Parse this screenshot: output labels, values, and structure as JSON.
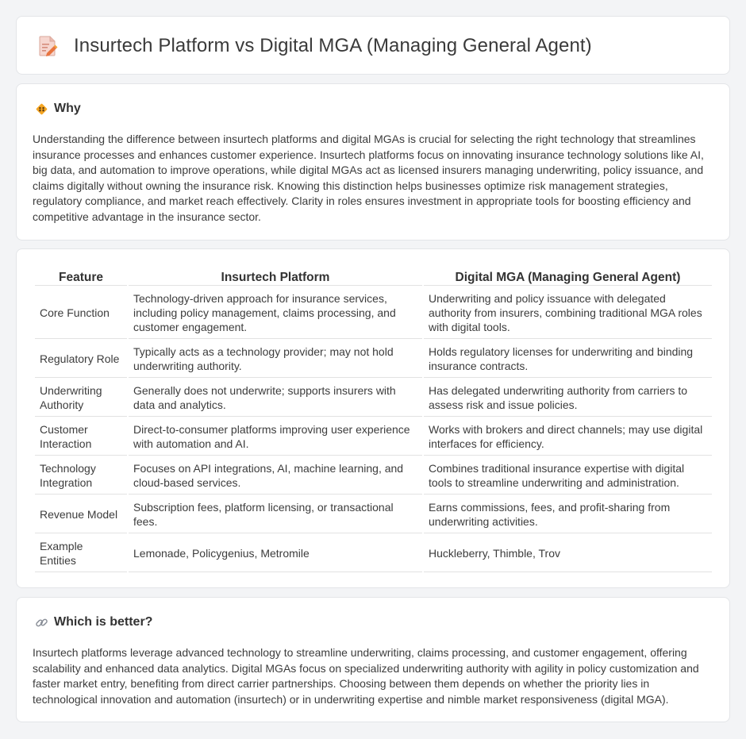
{
  "header": {
    "title": "Insurtech Platform vs Digital MGA (Managing General Agent)",
    "icon": "document-edit-icon"
  },
  "why": {
    "heading": "Why",
    "icon": "diamond-people-icon",
    "text": "Understanding the difference between insurtech platforms and digital MGAs is crucial for selecting the right technology that streamlines insurance processes and enhances customer experience. Insurtech platforms focus on innovating insurance technology solutions like AI, big data, and automation to improve operations, while digital MGAs act as licensed insurers managing underwriting, policy issuance, and claims digitally without owning the insurance risk. Knowing this distinction helps businesses optimize risk management strategies, regulatory compliance, and market reach effectively. Clarity in roles ensures investment in appropriate tools for boosting efficiency and competitive advantage in the insurance sector."
  },
  "table": {
    "headers": [
      "Feature",
      "Insurtech Platform",
      "Digital MGA (Managing General Agent)"
    ],
    "rows": [
      [
        "Core Function",
        "Technology-driven approach for insurance services, including policy management, claims processing, and customer engagement.",
        "Underwriting and policy issuance with delegated authority from insurers, combining traditional MGA roles with digital tools."
      ],
      [
        "Regulatory Role",
        "Typically acts as a technology provider; may not hold underwriting authority.",
        "Holds regulatory licenses for underwriting and binding insurance contracts."
      ],
      [
        "Underwriting Authority",
        "Generally does not underwrite; supports insurers with data and analytics.",
        "Has delegated underwriting authority from carriers to assess risk and issue policies."
      ],
      [
        "Customer Interaction",
        "Direct-to-consumer platforms improving user experience with automation and AI.",
        "Works with brokers and direct channels; may use digital interfaces for efficiency."
      ],
      [
        "Technology Integration",
        "Focuses on API integrations, AI, machine learning, and cloud-based services.",
        "Combines traditional insurance expertise with digital tools to streamline underwriting and administration."
      ],
      [
        "Revenue Model",
        "Subscription fees, platform licensing, or transactional fees.",
        "Earns commissions, fees, and profit-sharing from underwriting activities."
      ],
      [
        "Example Entities",
        "Lemonade, Policygenius, Metromile",
        "Huckleberry, Thimble, Trov"
      ]
    ]
  },
  "better": {
    "heading": "Which is better?",
    "icon": "link-icon",
    "text": "Insurtech platforms leverage advanced technology to streamline underwriting, claims processing, and customer engagement, offering scalability and enhanced data analytics. Digital MGAs focus on specialized underwriting authority with agility in policy customization and faster market entry, benefiting from direct carrier partnerships. Choosing between them depends on whether the priority lies in technological innovation and automation (insurtech) or in underwriting expertise and nimble market responsiveness (digital MGA)."
  }
}
